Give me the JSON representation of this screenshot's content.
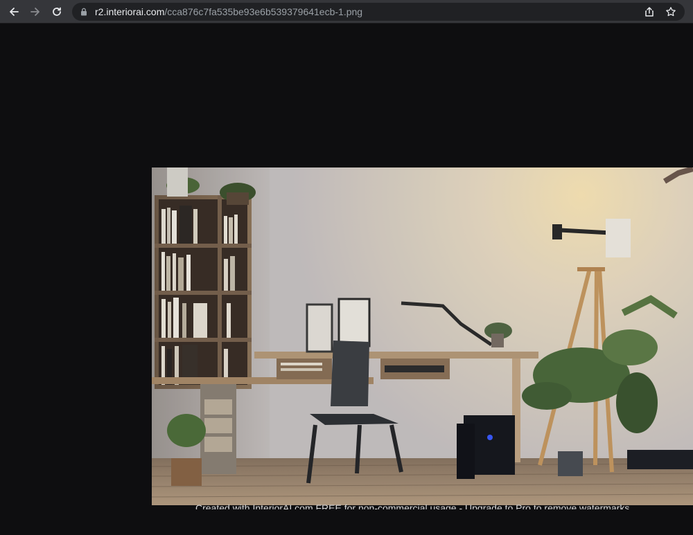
{
  "browser": {
    "url_host": "r2.interiorai.com",
    "url_path": "/cca876c7fa535be93e6b539379641ecb-1.png",
    "icons": {
      "back": "arrow-left-icon",
      "forward": "arrow-right-icon",
      "reload": "reload-icon",
      "lock": "lock-icon",
      "share": "share-icon",
      "bookmark": "star-icon"
    }
  },
  "image": {
    "subject": "AI-generated interior photo of a home office",
    "watermark": "Created with InteriorAI.com FREE for non-commercial usage - Upgrade to Pro to remove watermarks"
  },
  "colors": {
    "toolbar_bg": "#35363a",
    "address_bg": "#202124",
    "page_bg": "#0e0e10"
  }
}
